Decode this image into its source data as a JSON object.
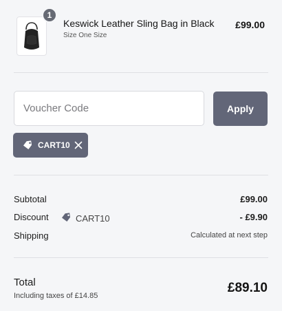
{
  "product": {
    "title": "Keswick Leather Sling Bag in Black",
    "size": "Size One Size",
    "price": "£99.00",
    "quantity": "1",
    "image_icon": "black-sling-bag"
  },
  "voucher": {
    "placeholder": "Voucher Code",
    "value": "",
    "apply_label": "Apply",
    "applied_code": "CART10"
  },
  "summary": {
    "subtotal_label": "Subtotal",
    "subtotal_value": "£99.00",
    "discount_label": "Discount",
    "discount_code": "CART10",
    "discount_value": "- £9.90",
    "shipping_label": "Shipping",
    "shipping_value": "Calculated at next step",
    "total_label": "Total",
    "tax_note": "Including taxes of £14.85",
    "total_value": "£89.10"
  },
  "colors": {
    "background": "#f5f6f8",
    "button": "#626678",
    "divider": "#dedfe3"
  }
}
